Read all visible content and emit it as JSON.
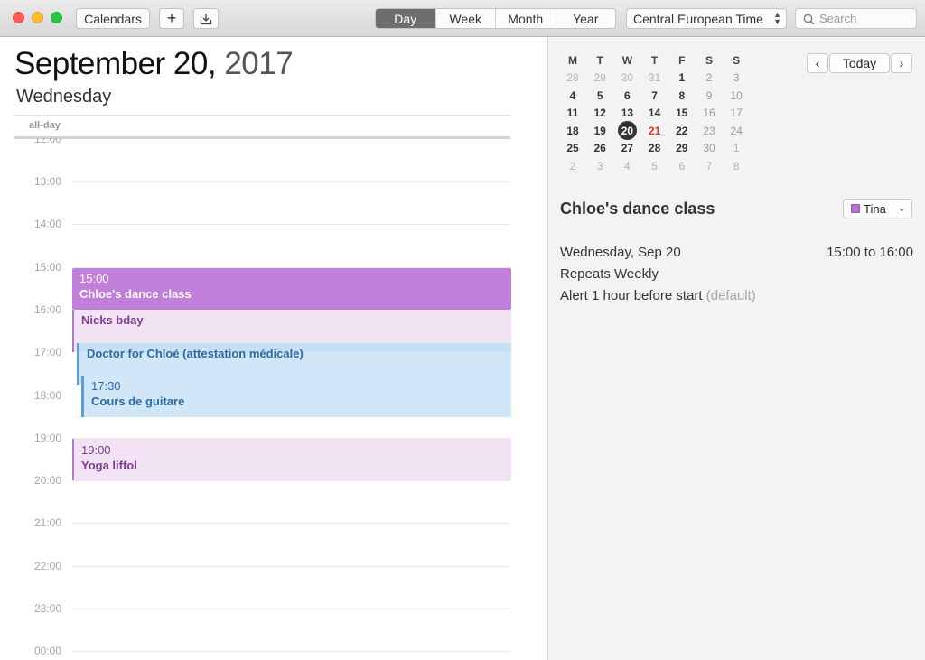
{
  "toolbar": {
    "calendars_label": "Calendars",
    "add_label": "+",
    "views": [
      "Day",
      "Week",
      "Month",
      "Year"
    ],
    "active_view": "Day",
    "timezone": "Central European Time",
    "search_placeholder": "Search"
  },
  "day": {
    "date": "September 20,",
    "year": "2017",
    "weekday": "Wednesday",
    "allday_label": "all-day",
    "hours": [
      "12:00",
      "13:00",
      "14:00",
      "15:00",
      "16:00",
      "17:00",
      "18:00",
      "19:00",
      "20:00",
      "21:00",
      "22:00",
      "23:00",
      "00:00"
    ],
    "events": [
      {
        "time": "15:00",
        "name": "Chloe's dance class"
      },
      {
        "time": "",
        "name": "Nicks bday"
      },
      {
        "time": "",
        "name": "Doctor for Chloé (attestation médicale)"
      },
      {
        "time": "17:30",
        "name": "Cours de guitare"
      },
      {
        "time": "19:00",
        "name": "Yoga liffol"
      }
    ]
  },
  "mini_calendar": {
    "weekdays": [
      "M",
      "T",
      "W",
      "T",
      "F",
      "S",
      "S"
    ],
    "weeks": [
      [
        "28",
        "29",
        "30",
        "31",
        "1",
        "2",
        "3"
      ],
      [
        "4",
        "5",
        "6",
        "7",
        "8",
        "9",
        "10"
      ],
      [
        "11",
        "12",
        "13",
        "14",
        "15",
        "16",
        "17"
      ],
      [
        "18",
        "19",
        "20",
        "21",
        "22",
        "23",
        "24"
      ],
      [
        "25",
        "26",
        "27",
        "28",
        "29",
        "30",
        "1"
      ],
      [
        "2",
        "3",
        "4",
        "5",
        "6",
        "7",
        "8"
      ]
    ],
    "selected_day": "20",
    "today_day": "21",
    "prev_label": "‹",
    "today_label": "Today",
    "next_label": "›"
  },
  "detail": {
    "title": "Chloe's dance class",
    "calendar": "Tina",
    "calendar_color": "#b56fd0",
    "date": "Wednesday, Sep 20",
    "time": "15:00 to 16:00",
    "repeat": "Repeats Weekly",
    "alert": "Alert 1 hour before start",
    "alert_suffix": "(default)"
  }
}
